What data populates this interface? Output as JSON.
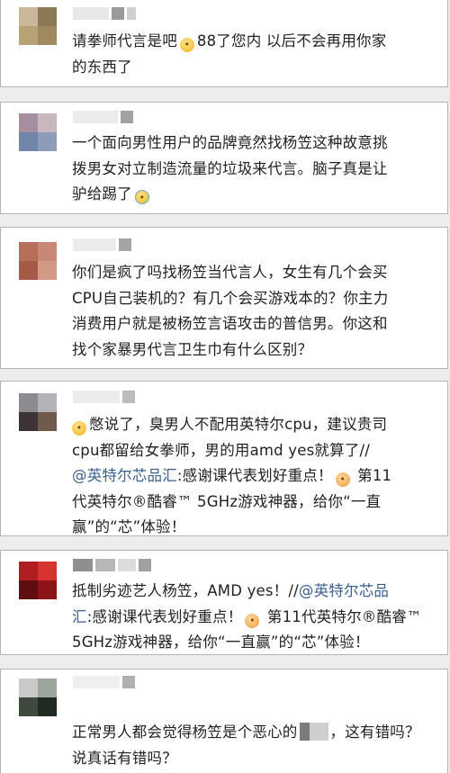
{
  "comments": [
    {
      "text_lines": [
        "请拳师代言是吧",
        "88了您内  以后不会再用你家",
        "的东西了"
      ],
      "emoji": "sad-face-icon"
    },
    {
      "text_lines": [
        "一个面向男性用户的品牌竟然找杨笠这种故意挑",
        "拨男女对立制造流量的垃圾来代言。脑子真是让",
        "驴给踢了"
      ],
      "emoji": "crying-laugh-icon"
    },
    {
      "text_lines": [
        "你们是疯了吗找杨笠当代言人，女生有几个会买",
        "CPU自己装机的？有几个会买游戏本的？你主力",
        "消费用户就是被杨笠言语攻击的普信男。你这和",
        "找个家暴男代言卫生巾有什么区别？"
      ]
    },
    {
      "text_lines": [
        "憋说了，臭男人不配用英特尔cpu，建议贵司",
        "cpu都留给女拳师，男的用amd yes就算了//"
      ],
      "mention": "@英特尔芯品汇",
      "after_mention": ":感谢课代表划好重点！",
      "after_emoji": " 第11",
      "text_lines_tail": [
        "代英特尔®酷睿™ 5GHz游戏神器，给你“一直",
        "赢”的“芯”体验！"
      ]
    },
    {
      "line1": "抵制劣迹艺人杨笠，AMD yes！//",
      "mention_a": "@英特尔芯品",
      "mention_b": "汇",
      "after_mention": ":感谢课代表划好重点！",
      "after_emoji": " 第11代英特尔®酷睿™",
      "line3": "5GHz游戏神器，给你“一直赢”的“芯”体验！"
    },
    {
      "line1_a": "正常男人都会觉得杨笠是个恶心的",
      "line1_b": "，这有错吗？",
      "line2": "说真话有错吗？"
    }
  ],
  "colors": {
    "background": "#ededed",
    "card": "#ffffff",
    "text": "#222222",
    "mention": "#3b5f8f"
  }
}
